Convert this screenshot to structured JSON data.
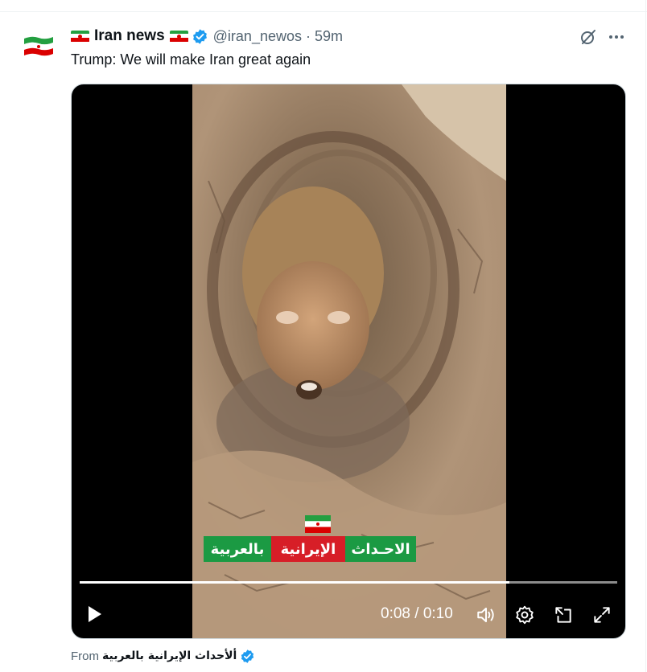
{
  "tweet": {
    "display_name": "Iran news",
    "handle": "@iran_newos",
    "separator": "·",
    "time": "59m",
    "text": "Trump: We will make Iran great again"
  },
  "video": {
    "banner_segments": [
      "الاحـداث",
      "الإيرانية",
      "بالعربية"
    ],
    "current_time": "0:08",
    "duration": "0:10",
    "time_display": "0:08 / 0:10",
    "progress_fraction": 0.8,
    "controls": [
      "play-icon",
      "volume-icon",
      "settings-icon",
      "picture-in-picture-icon",
      "fullscreen-icon"
    ]
  },
  "source": {
    "prefix": "From",
    "name": "ألأحداث الإيرانية بالعربية"
  },
  "colors": {
    "accent_blue": "#1d9bf0",
    "text_primary": "#0f1419",
    "text_secondary": "#536471",
    "flag_green": "#239f40",
    "flag_red": "#da0000"
  }
}
